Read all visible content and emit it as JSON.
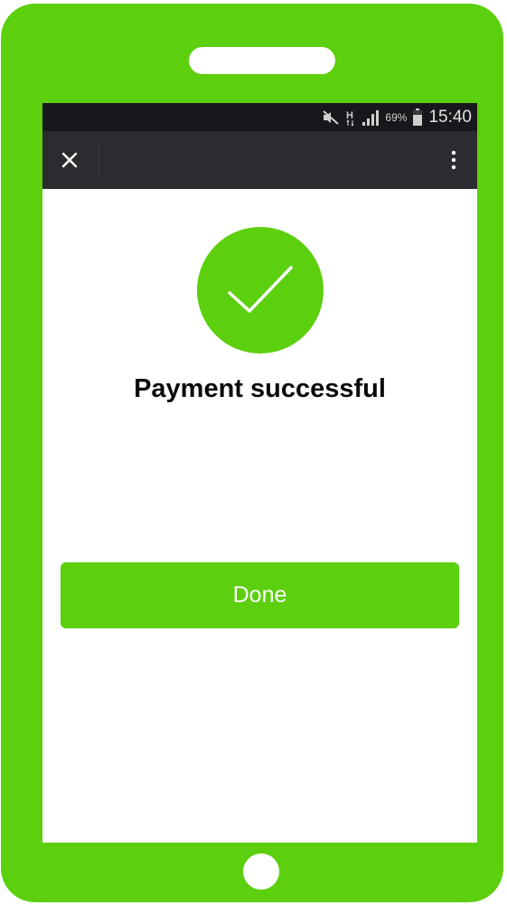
{
  "colors": {
    "phone_body": "#5ccf0e",
    "status_bar": "#17181b",
    "app_bar": "#2b2c30",
    "accent": "#5ccf0e",
    "button_text": "#ffffff"
  },
  "status_bar": {
    "icons": [
      "mute-icon",
      "hspa-network-icon",
      "signal-icon",
      "battery-icon"
    ],
    "network_label": "H",
    "battery_percent": "69%",
    "time": "15:40"
  },
  "app_bar": {
    "close_icon": "close-icon",
    "overflow_icon": "more-vert-icon"
  },
  "content": {
    "status_icon": "checkmark-icon",
    "title": "Payment successful",
    "done_label": "Done"
  }
}
